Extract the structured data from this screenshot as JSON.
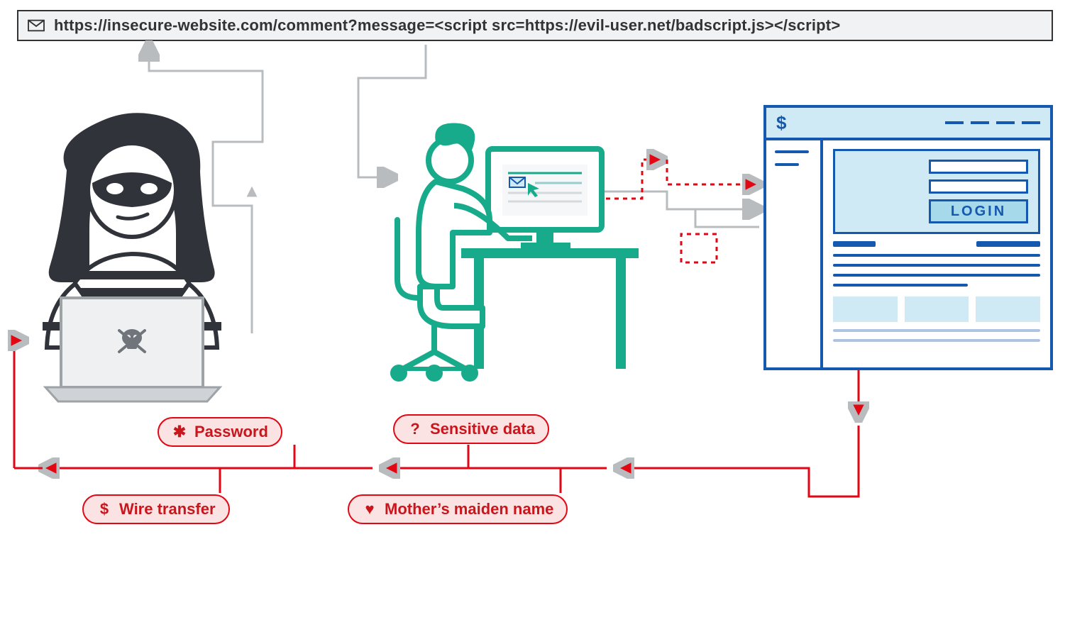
{
  "urlbar": {
    "text": "https://insecure-website.com/comment?message=<script src=https://evil-user.net/badscript.js></script>"
  },
  "bank": {
    "login_label": "LOGIN",
    "currency_symbol": "$"
  },
  "pills": {
    "password": {
      "icon": "✱",
      "label": "Password"
    },
    "sensitive": {
      "icon": "?",
      "label": "Sensitive data"
    },
    "wire": {
      "icon": "$",
      "label": "Wire transfer"
    },
    "maiden": {
      "icon": "♥",
      "label": "Mother’s maiden name"
    }
  },
  "colors": {
    "attacker": "#30343a",
    "victim": "#17ab8b",
    "bank": "#1558b0",
    "flow_bad": "#e30613",
    "flow_gray": "#b9bcbf"
  }
}
